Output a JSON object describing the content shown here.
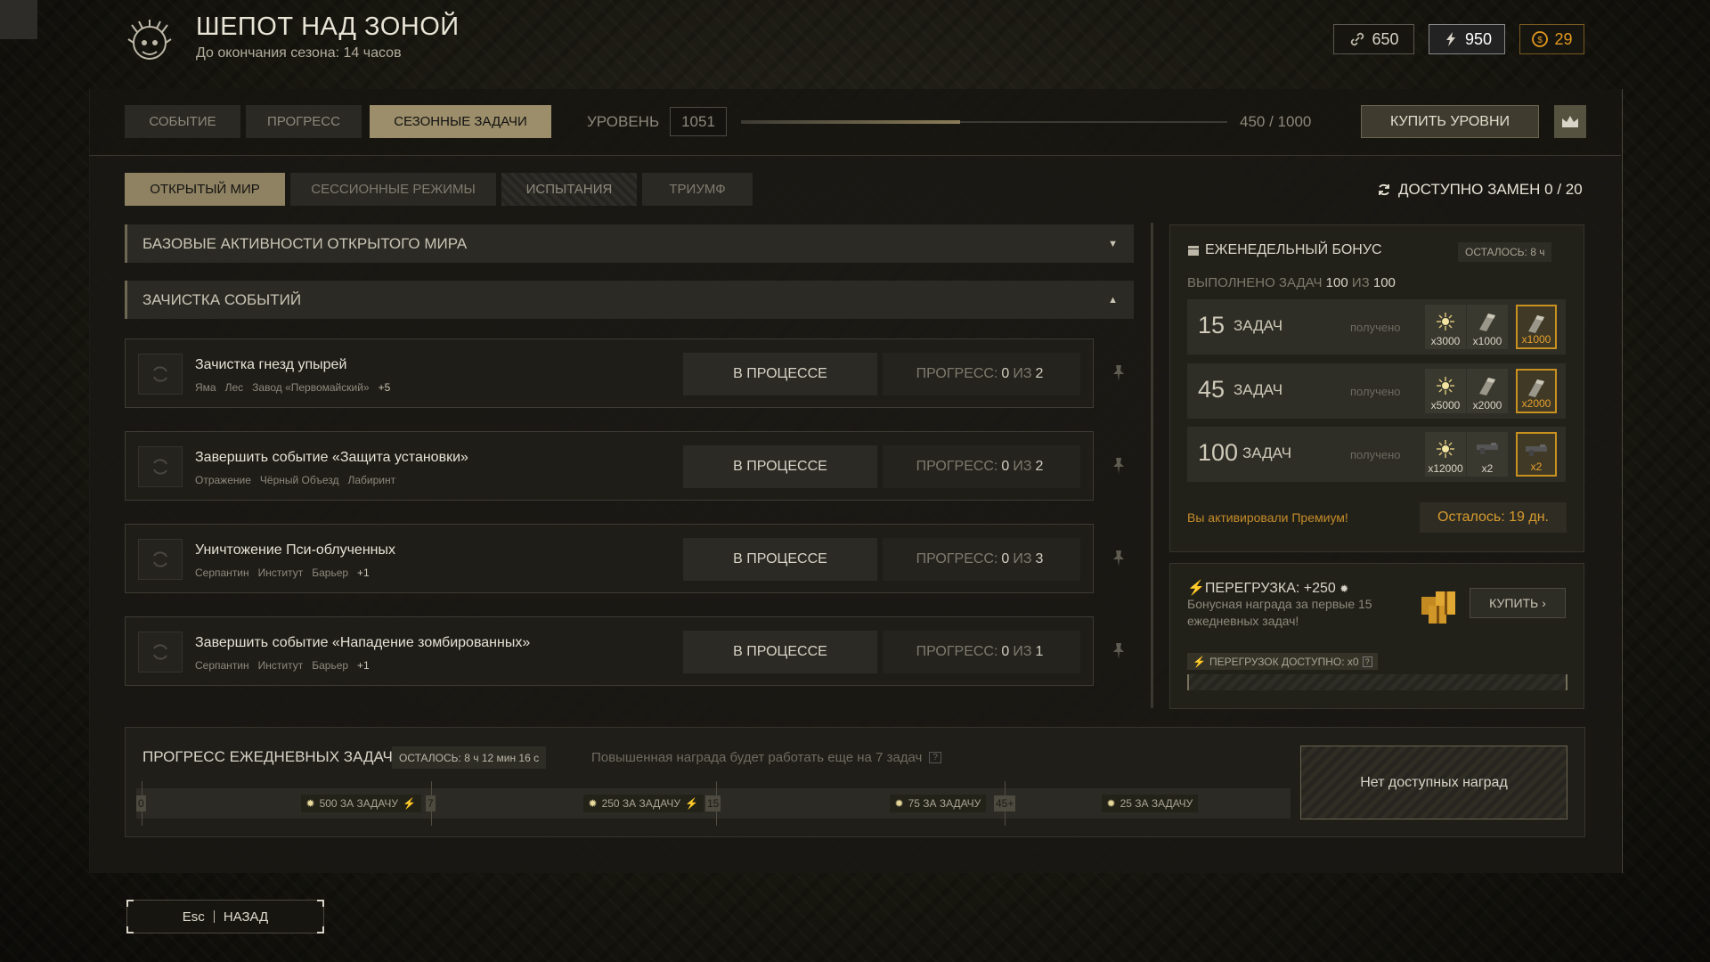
{
  "header": {
    "title": "ШЕПОТ НАД ЗОНОЙ",
    "subtitle": "До окончания сезона: 14 часов",
    "currencies": [
      {
        "icon": "link-icon",
        "value": "650"
      },
      {
        "icon": "lightning-icon",
        "value": "950"
      },
      {
        "icon": "coin-icon",
        "value": "29",
        "color": "#e59a1f"
      }
    ]
  },
  "tabs": [
    "СОБЫТИЕ",
    "ПРОГРЕСС",
    "СЕЗОННЫЕ ЗАДАЧИ"
  ],
  "level": {
    "label": "УРОВЕНЬ",
    "value": "1051",
    "progress_text": "450 / 1000",
    "progress_fraction": 0.45,
    "buy_label": "КУПИТЬ УРОВНИ"
  },
  "subtabs": [
    "ОТКРЫТЫЙ МИР",
    "СЕССИОННЫЕ РЕЖИМЫ",
    "ИСПЫТАНИЯ",
    "ТРИУМФ"
  ],
  "replacements": "ДОСТУПНО ЗАМЕН 0 / 20",
  "groups": [
    {
      "title": "БАЗОВЫЕ АКТИВНОСТИ ОТКРЫТОГО МИРА",
      "arrow": "▼"
    },
    {
      "title": "ЗАЧИСТКА СОБЫТИЙ",
      "arrow": "▲"
    }
  ],
  "tasks": [
    {
      "name": "Зачистка гнезд упырей",
      "tags": [
        "Яма",
        "Лес",
        "Завод «Первомайский»"
      ],
      "more": "+5",
      "status": "В ПРОЦЕССЕ",
      "progress_label": "ПРОГРЕСС:",
      "current": "0",
      "of": "ИЗ",
      "total": "2"
    },
    {
      "name": "Завершить событие «Защита установки»",
      "tags": [
        "Отражение",
        "Чёрный Объезд",
        "Лабиринт"
      ],
      "more": "",
      "status": "В ПРОЦЕССЕ",
      "progress_label": "ПРОГРЕСС:",
      "current": "0",
      "of": "ИЗ",
      "total": "2"
    },
    {
      "name": "Уничтожение Пси-облученных",
      "tags": [
        "Серпантин",
        "Институт",
        "Барьер"
      ],
      "more": "+1",
      "status": "В ПРОЦЕССЕ",
      "progress_label": "ПРОГРЕСС:",
      "current": "0",
      "of": "ИЗ",
      "total": "3"
    },
    {
      "name": "Завершить событие «Нападение зомбированных»",
      "tags": [
        "Серпантин",
        "Институт",
        "Барьер"
      ],
      "more": "+1",
      "status": "В ПРОЦЕССЕ",
      "progress_label": "ПРОГРЕСС:",
      "current": "0",
      "of": "ИЗ",
      "total": "1"
    }
  ],
  "weekly": {
    "title": "ЕЖЕНЕДЕЛЬНЫЙ БОНУС",
    "left": "ОСТАЛОСЬ: 8 ч",
    "done_prefix": "ВЫПОЛНЕНО ЗАДАЧ",
    "done_value": "100",
    "done_of": "ИЗ",
    "done_total": "100",
    "tiers": [
      {
        "num": "15",
        "label": "ЗАДАЧ",
        "status": "получено",
        "rewards": [
          {
            "icon": "sun-icon",
            "qty": "x3000"
          },
          {
            "icon": "ingot-icon",
            "qty": "x1000"
          },
          {
            "icon": "ingot-icon",
            "qty": "x1000",
            "premium": true
          }
        ]
      },
      {
        "num": "45",
        "label": "ЗАДАЧ",
        "status": "получено",
        "rewards": [
          {
            "icon": "sun-icon",
            "qty": "x5000"
          },
          {
            "icon": "ingot-icon",
            "qty": "x2000"
          },
          {
            "icon": "ingot-icon",
            "qty": "x2000",
            "premium": true
          }
        ]
      },
      {
        "num": "100",
        "label": "ЗАДАЧ",
        "status": "получено",
        "rewards": [
          {
            "icon": "sun-icon",
            "qty": "x12000"
          },
          {
            "icon": "gun-icon",
            "qty": "x2"
          },
          {
            "icon": "gun-icon",
            "qty": "x2",
            "premium": true
          }
        ]
      }
    ],
    "premium_text": "Вы активировали Премиум!",
    "premium_left": "Осталось: 19 дн."
  },
  "overload": {
    "title": "ПЕРЕГРУЗКА: +250",
    "desc": "Бонусная награда за первые 15 ежедневных задач!",
    "buy_label": "КУПИТЬ",
    "available": "ПЕРЕГРУЗОК ДОСТУПНО: x0"
  },
  "daily": {
    "title": "ПРОГРЕСС ЕЖЕДНЕВНЫХ ЗАДАЧ",
    "left": "ОСТАЛОСЬ: 8 ч 12 мин 16 с",
    "note": "Повышенная награда будет работать еще на 7 задач",
    "milestones": [
      "0",
      "7",
      "15",
      "45+"
    ],
    "segments": [
      "500 ЗА ЗАДАЧУ",
      "250 ЗА ЗАДАЧУ",
      "75 ЗА ЗАДАЧУ",
      "25 ЗА ЗАДАЧУ"
    ],
    "no_rewards": "Нет доступных наград"
  },
  "footer": {
    "key": "Esc",
    "label": "НАЗАД"
  },
  "colors": {
    "accent": "#9c8e6a",
    "gold": "#e59a1f",
    "premium": "#c48c2a"
  }
}
